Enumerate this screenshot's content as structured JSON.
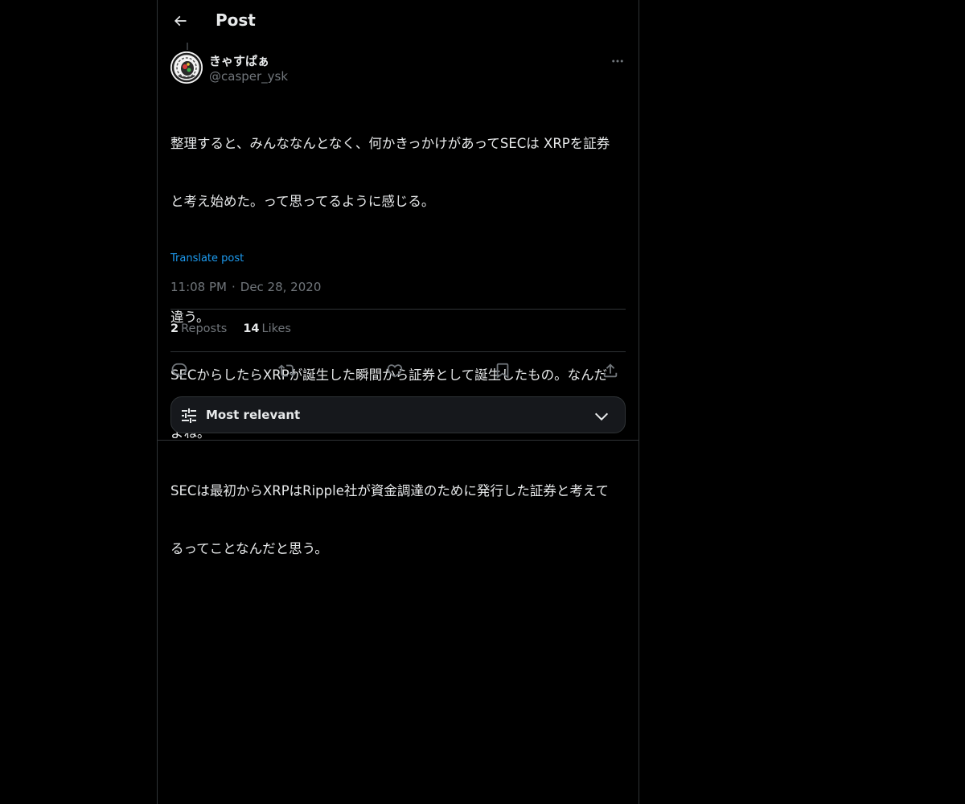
{
  "header": {
    "title": "Post"
  },
  "post": {
    "author_name": "きゃすぱぁ",
    "author_handle": "@casper_ysk",
    "body_lines": [
      "整理すると、みんななんとなく、何かきっかけがあってSECは XRPを証券",
      "と考え始めた。って思ってるように感じる。",
      "",
      "違う。",
      "SECからしたらXRPが誕生した瞬間から証券として誕生したもの。なんだ",
      "よね。",
      "SECは最初からXRPはRipple社が資金調達のために発行した証券と考えて",
      "るってことなんだと思う。"
    ],
    "translate_label": "Translate post",
    "time": "11:08 PM",
    "separator": "·",
    "date": "Dec 28, 2020"
  },
  "stats": {
    "reposts_count": "2",
    "reposts_label": "Reposts",
    "likes_count": "14",
    "likes_label": "Likes"
  },
  "actions": {
    "icons": [
      "reply-icon",
      "repost-icon",
      "like-icon",
      "bookmark-icon",
      "share-icon"
    ]
  },
  "sort": {
    "label": "Most relevant"
  },
  "colors": {
    "background": "#000000",
    "text": "#e7e9ea",
    "muted": "#71767b",
    "link": "#1d9bf0",
    "border": "#2f3336"
  }
}
